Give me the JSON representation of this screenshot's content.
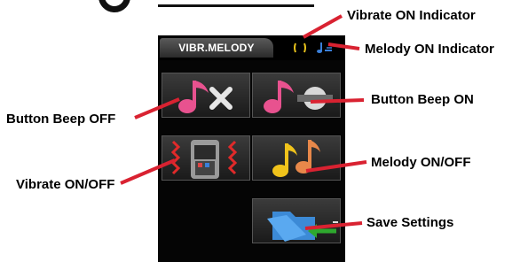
{
  "screen": {
    "title": "VIBR.MELODY"
  },
  "indicators": {
    "vibrate_icon": "vibrate-indicator-icon",
    "melody_icon": "melody-indicator-icon"
  },
  "buttons": [
    {
      "name": "button-beep-off",
      "icon": "note-x-icon"
    },
    {
      "name": "button-beep-on",
      "icon": "note-speaker-icon"
    },
    {
      "name": "vibrate-toggle",
      "icon": "vibrating-phone-icon"
    },
    {
      "name": "melody-toggle",
      "icon": "double-note-icon"
    },
    {
      "name": "save-settings",
      "icon": "folder-arrow-icon"
    }
  ],
  "callouts": {
    "vibrate_on_indicator": "Vibrate ON Indicator",
    "melody_on_indicator": "Melody ON Indicator",
    "button_beep_on": "Button Beep ON",
    "button_beep_off": "Button Beep OFF",
    "melody_on_off": "Melody ON/OFF",
    "vibrate_on_off": "Vibrate ON/OFF",
    "save_settings": "Save Settings"
  },
  "colors": {
    "callout_line": "#d92231",
    "device_bg": "#050505",
    "vibrate_indicator": "#e8c21b",
    "melody_indicator": "#3a7fd9"
  }
}
